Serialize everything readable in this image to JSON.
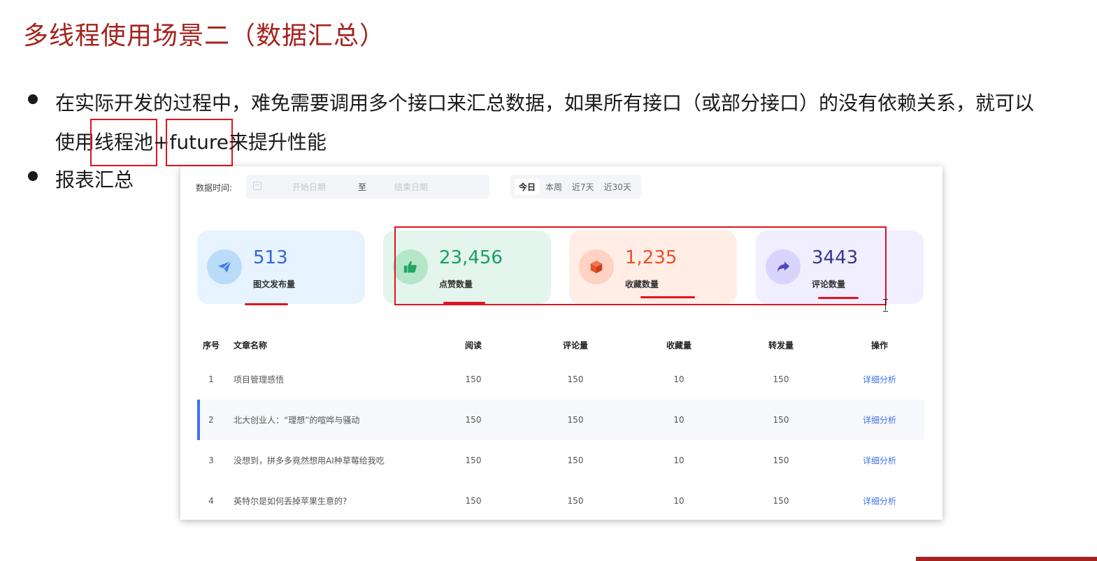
{
  "slide": {
    "title": "多线程使用场景二（数据汇总）",
    "bullets": [
      {
        "line1": "在实际开发的过程中，难免需要调用多个接口来汇总数据，如果所有接口（或部分接口）的没有依赖关系，就可以",
        "line2_prefix": "使用",
        "line2_highlight1": "线程池",
        "line2_plus": "+",
        "line2_highlight2": "future",
        "line2_suffix": "来提升性能"
      },
      {
        "text": "报表汇总"
      }
    ],
    "accent_color": "#a3231e"
  },
  "dashboard": {
    "filter": {
      "label": "数据时间:",
      "start_placeholder": "开始日期",
      "separator": "至",
      "end_placeholder": "结束日期",
      "quick_ranges": [
        "今日",
        "本周",
        "近7天",
        "近30天"
      ],
      "active_range": "今日"
    },
    "stats": [
      {
        "value": "513",
        "label": "图文发布量",
        "icon": "paper-plane-icon",
        "color": "#3563d8"
      },
      {
        "value": "23,456",
        "label": "点赞数量",
        "icon": "thumbs-up-icon",
        "color": "#18a060"
      },
      {
        "value": "1,235",
        "label": "收藏数量",
        "icon": "cube-icon",
        "color": "#e8512b"
      },
      {
        "value": "3443",
        "label": "评论数量",
        "icon": "share-arrow-icon",
        "color": "#3a3790"
      }
    ],
    "table": {
      "columns": [
        "序号",
        "文章名称",
        "阅读",
        "评论量",
        "收藏量",
        "转发量",
        "操作"
      ],
      "rows": [
        {
          "idx": "1",
          "name": "项目管理感悟",
          "read": "150",
          "comments": "150",
          "favorites": "10",
          "forwards": "150",
          "action": "详细分析"
        },
        {
          "idx": "2",
          "name": "北大创业人：“理想”的喧哗与骚动",
          "read": "150",
          "comments": "150",
          "favorites": "10",
          "forwards": "150",
          "action": "详细分析"
        },
        {
          "idx": "3",
          "name": "没想到，拼多多竟然想用AI种草莓给我吃",
          "read": "150",
          "comments": "150",
          "favorites": "10",
          "forwards": "150",
          "action": "详细分析"
        },
        {
          "idx": "4",
          "name": "英特尔是如何丢掉苹果生意的?",
          "read": "150",
          "comments": "150",
          "favorites": "10",
          "forwards": "150",
          "action": "详细分析"
        }
      ],
      "link_color": "#3f72ea"
    }
  }
}
